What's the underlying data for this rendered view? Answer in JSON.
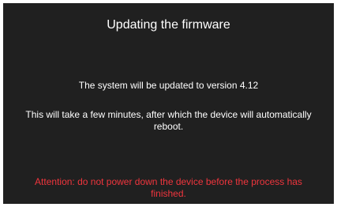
{
  "dialog": {
    "title": "Updating the firmware",
    "version_message": "The system will be updated to version 4.12",
    "reboot_message": "This will take a few minutes, after which the device will automatically reboot.",
    "warning_message": "Attention: do not power down the device before the process has finished."
  },
  "colors": {
    "background": "#202020",
    "text": "#ffffff",
    "warning": "#f0353d"
  }
}
